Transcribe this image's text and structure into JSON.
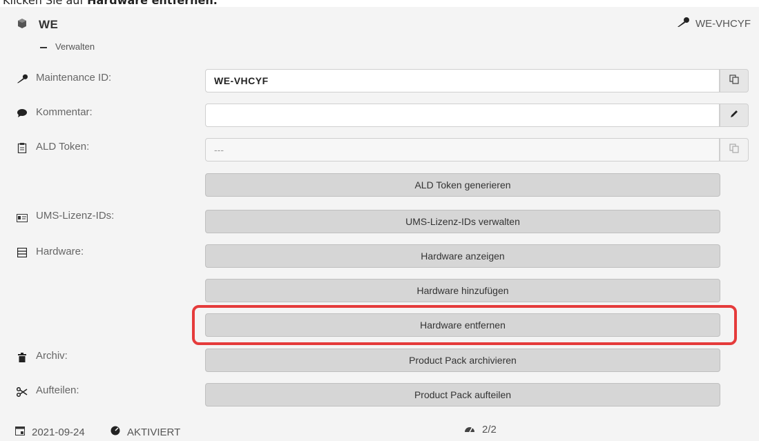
{
  "caption": {
    "prefix": "Klicken Sie auf ",
    "bold": "Hardware entfernen."
  },
  "header": {
    "title": "WE",
    "subtitle": "Verwalten",
    "key_label": "WE-VHCYF"
  },
  "fields": {
    "maintenance": {
      "label": "Maintenance ID:",
      "value": "WE-VHCYF"
    },
    "comment": {
      "label": "Kommentar:",
      "value": ""
    },
    "ald": {
      "label": "ALD Token:",
      "value": "---"
    }
  },
  "labels": {
    "ums": "UMS-Lizenz-IDs:",
    "hardware": "Hardware:",
    "archive": "Archiv:",
    "split": "Aufteilen:"
  },
  "buttons": {
    "ald_generate": "ALD Token generieren",
    "ums_manage": "UMS-Lizenz-IDs verwalten",
    "hw_show": "Hardware anzeigen",
    "hw_add": "Hardware hinzufügen",
    "hw_remove": "Hardware entfernen",
    "pp_archive": "Product Pack archivieren",
    "pp_split": "Product Pack aufteilen"
  },
  "footer": {
    "date": "2021-09-24",
    "status": "AKTIVIERT",
    "count": "2/2"
  },
  "colors": {
    "highlight": "#e53b3b",
    "button_bg": "#d6d6d6",
    "panel_bg": "#f4f4f4"
  }
}
